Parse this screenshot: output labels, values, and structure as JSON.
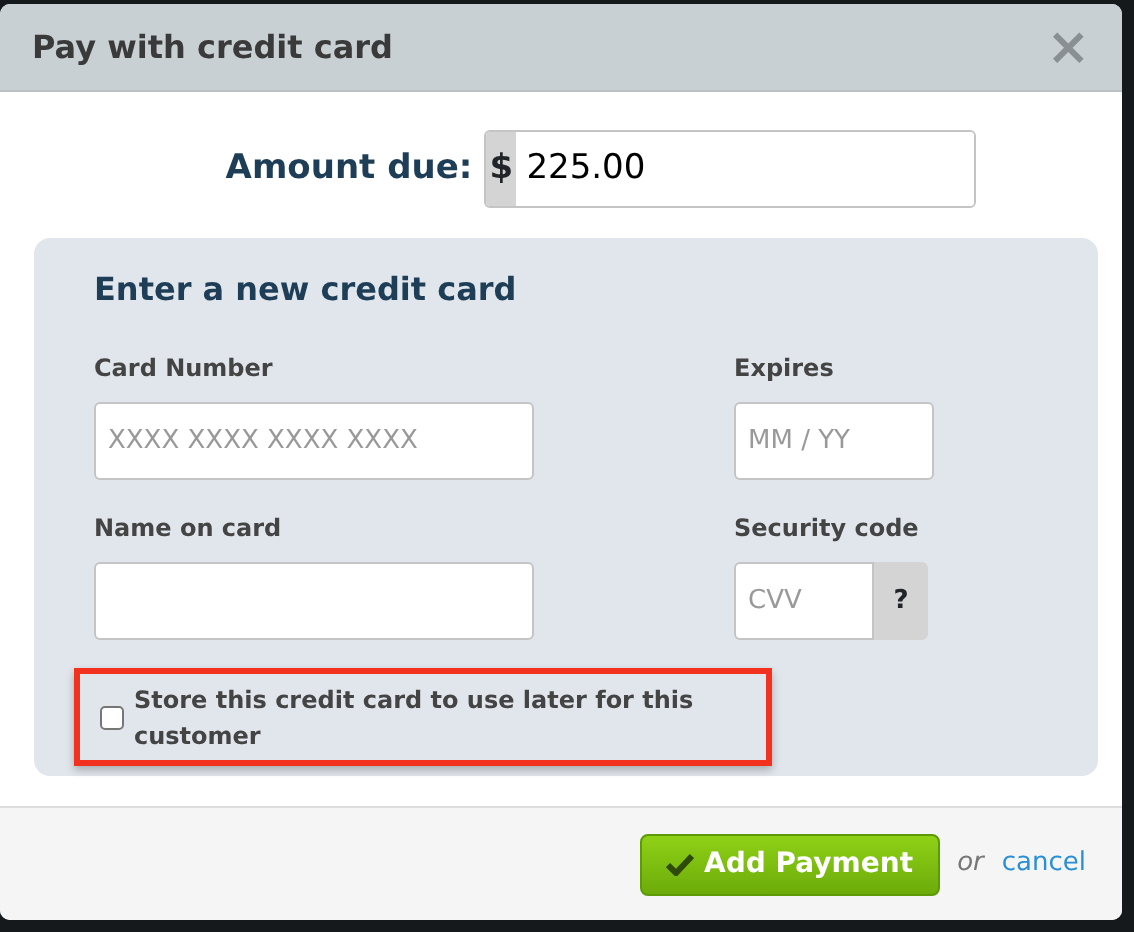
{
  "dialog": {
    "title": "Pay with credit card",
    "close": "×"
  },
  "amount": {
    "label": "Amount due:",
    "currency": "$",
    "value": "225.00"
  },
  "card_form": {
    "title": "Enter a new credit card",
    "card_number": {
      "label": "Card Number",
      "placeholder": "XXXX XXXX XXXX XXXX"
    },
    "expires": {
      "label": "Expires",
      "placeholder": "MM / YY"
    },
    "name": {
      "label": "Name on card"
    },
    "security": {
      "label": "Security code",
      "placeholder": "CVV",
      "help": "?"
    },
    "store_card": {
      "label": "Store this credit card to use later for this customer",
      "checked": false,
      "highlighted": true
    }
  },
  "footer": {
    "submit": "Add Payment",
    "or": "or",
    "cancel": "cancel"
  }
}
